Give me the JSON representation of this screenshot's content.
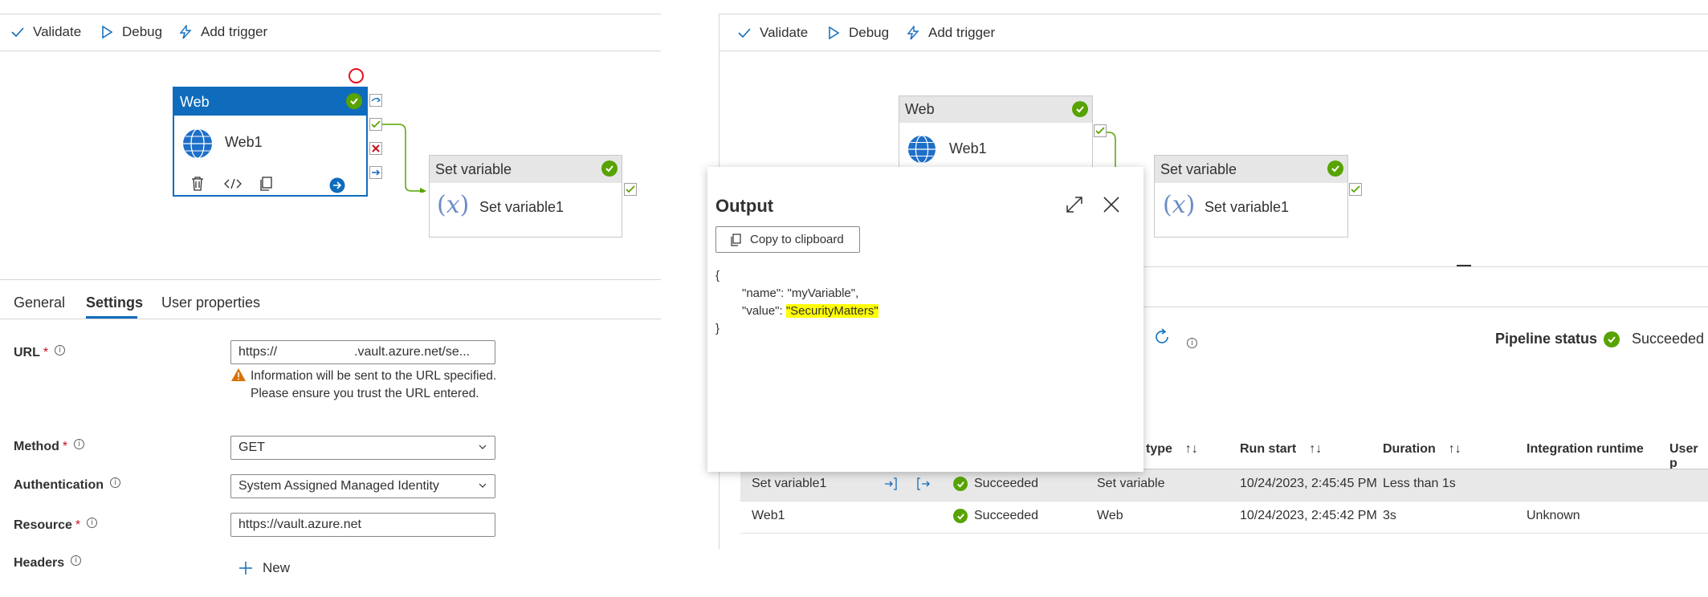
{
  "toolbar": {
    "validate": "Validate",
    "debug": "Debug",
    "add_trigger": "Add trigger"
  },
  "canvas": {
    "web_node": {
      "header": "Web",
      "name": "Web1"
    },
    "setvar_node": {
      "header": "Set variable",
      "name": "Set variable1"
    }
  },
  "tabs": {
    "general": "General",
    "settings": "Settings",
    "user_properties": "User properties"
  },
  "settings": {
    "url_label": "URL",
    "url_value_prefix": "https://",
    "url_value_suffix": ".vault.azure.net/se...",
    "url_warning": "Information will be sent to the URL specified. Please ensure you trust the URL entered.",
    "method_label": "Method",
    "method_value": "GET",
    "auth_label": "Authentication",
    "auth_value": "System Assigned Managed Identity",
    "resource_label": "Resource",
    "resource_value": "https://vault.azure.net",
    "headers_label": "Headers",
    "new_label": "New",
    "required_mark": "*"
  },
  "output": {
    "title": "Output",
    "copy_label": "Copy to clipboard",
    "json_open": "{",
    "line1": "\"name\": \"myVariable\",",
    "line2_key": "\"value\": ",
    "line2_value": "\"SecurityMatters\"",
    "json_close": "}"
  },
  "monitor": {
    "pipeline_status_label": "Pipeline status",
    "pipeline_status_value": "Succeeded",
    "columns": [
      "type",
      "Run start",
      "Duration",
      "Integration runtime",
      "User p"
    ],
    "rows": [
      {
        "name": "Set variable1",
        "status": "Succeeded",
        "type": "Set variable",
        "run_start": "10/24/2023, 2:45:45 PM",
        "duration": "Less than 1s",
        "runtime": ""
      },
      {
        "name": "Web1",
        "status": "Succeeded",
        "type": "Web",
        "run_start": "10/24/2023, 2:45:42 PM",
        "duration": "3s",
        "runtime": "Unknown"
      }
    ]
  },
  "colors": {
    "accent": "#0f6cbd",
    "success": "#57a300",
    "error": "#c50f1f",
    "highlight": "#ffff00"
  }
}
